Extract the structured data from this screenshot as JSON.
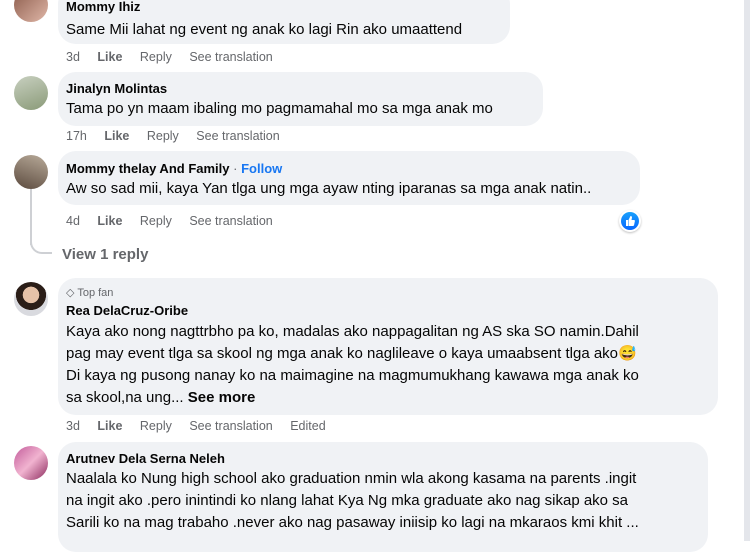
{
  "comments": [
    {
      "author": "Mommy Ihiz",
      "text": "Same Mii lahat ng event ng anak ko lagi Rin ako umaattend",
      "time": "3d",
      "like": "Like",
      "reply": "Reply",
      "translate": "See translation"
    },
    {
      "author": "Jinalyn Molintas",
      "text": "Tama po yn maam ibaling mo pagmamahal mo sa mga anak mo",
      "time": "17h",
      "like": "Like",
      "reply": "Reply",
      "translate": "See translation"
    },
    {
      "author": "Mommy thelay And Family",
      "follow": "Follow",
      "separator": "·",
      "text": "Aw so sad mii, kaya Yan tlga ung mga ayaw nting iparanas sa mga anak natin..",
      "time": "4d",
      "like": "Like",
      "reply": "Reply",
      "translate": "See translation",
      "reaction_icon": "like-reaction-icon"
    },
    {
      "badge": "Top fan",
      "author": "Rea DelaCruz-Oribe",
      "lines": [
        "Kaya ako nong nagttrbho pa ko, madalas ako nappagalitan ng AS ska SO namin.Dahil",
        "pag may event tlga sa skool ng mga anak ko naglileave o kaya umaabsent tlga ako",
        "Di kaya ng pusong nanay ko na maimagine na magmumukhang kawawa mga anak ko",
        "sa skool,na ung..."
      ],
      "see_more": "See more",
      "emoji": "😅",
      "time": "3d",
      "like": "Like",
      "reply": "Reply",
      "translate": "See translation",
      "edited": "Edited"
    },
    {
      "author": "Arutnev Dela Serna Neleh",
      "lines": [
        "Naalala ko Nung high school ako graduation nmin wla akong kasama na parents .ingit",
        "na ingit ako .pero inintindi ko nlang lahat Kya Ng mka graduate ako nag sikap ako sa",
        "Sarili ko na mag trabaho .never ako nag pasaway iniisip ko lagi na mkaraos kmi khit ..."
      ]
    }
  ],
  "view_replies": "View 1 reply",
  "colors": {
    "bubble": "#f0f2f5",
    "meta": "#65676b",
    "link": "#1877f2"
  }
}
